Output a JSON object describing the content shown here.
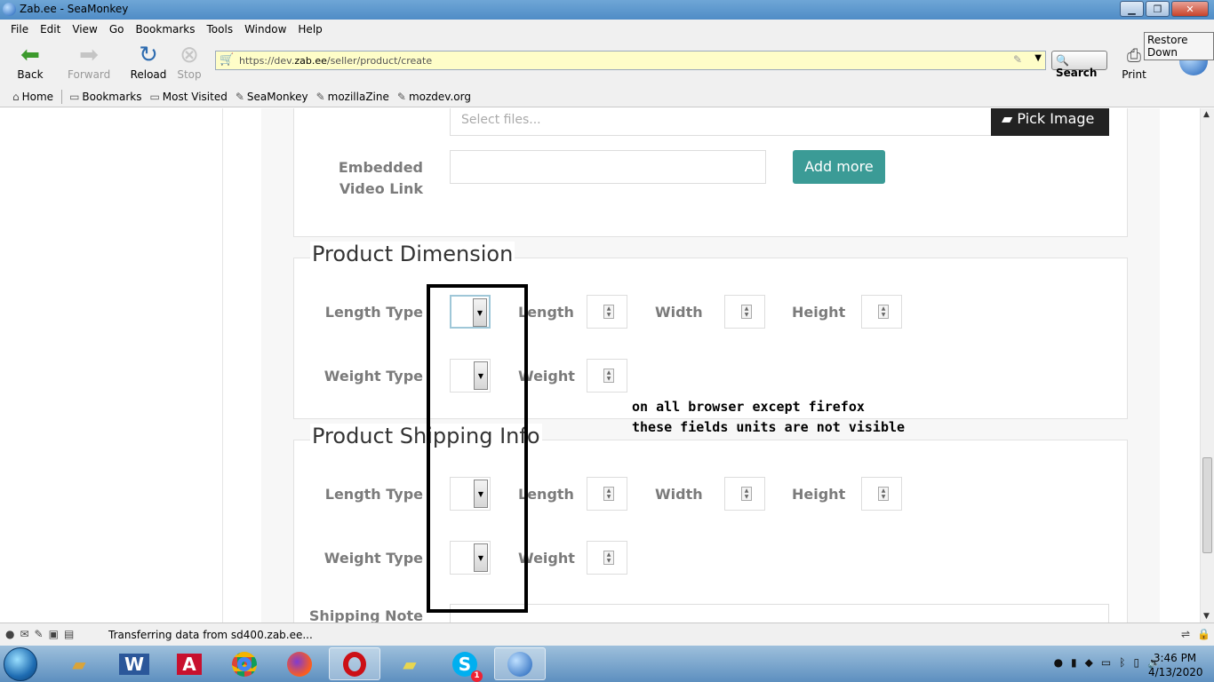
{
  "window": {
    "title": "Zab.ee - SeaMonkey",
    "tooltip": "Restore Down"
  },
  "menubar": {
    "items": [
      "File",
      "Edit",
      "View",
      "Go",
      "Bookmarks",
      "Tools",
      "Window",
      "Help"
    ]
  },
  "navbar": {
    "back": "Back",
    "forward": "Forward",
    "reload": "Reload",
    "stop": "Stop",
    "url_prefix": "https://dev.",
    "url_domain": "zab.ee",
    "url_path": "/seller/product/create",
    "search": "Search",
    "print": "Print"
  },
  "personal_toolbar": {
    "items": [
      "Home",
      "Bookmarks",
      "Most Visited",
      "SeaMonkey",
      "mozillaZine",
      "mozdev.org"
    ]
  },
  "form": {
    "select_files_placeholder": "Select files...",
    "pick_image": "Pick Image",
    "embedded_video_label_1": "Embedded",
    "embedded_video_label_2": "Video Link",
    "add_more": "Add more",
    "dimension_section": {
      "title": "Product Dimension",
      "length_type": "Length Type",
      "length": "Length",
      "width": "Width",
      "height": "Height",
      "weight_type": "Weight Type",
      "weight": "Weight"
    },
    "shipping_section": {
      "title": "Product Shipping Info",
      "length_type": "Length Type",
      "length": "Length",
      "width": "Width",
      "height": "Height",
      "weight_type": "Weight Type",
      "weight": "Weight",
      "shipping_note": "Shipping Note"
    }
  },
  "annotation": {
    "line1": "on all browser except firefox",
    "line2": "these fields units are not visible"
  },
  "statusbar": {
    "message": "Transferring data from sd400.zab.ee..."
  },
  "taskbar": {
    "apps": [
      "Windows Explorer",
      "Microsoft Word",
      "Adobe Acrobat",
      "Google Chrome",
      "Firefox",
      "Opera",
      "Sticky Notes",
      "Skype",
      "SeaMonkey"
    ],
    "skype_badge": "1",
    "time": "3:46 PM",
    "date": "4/13/2020"
  }
}
